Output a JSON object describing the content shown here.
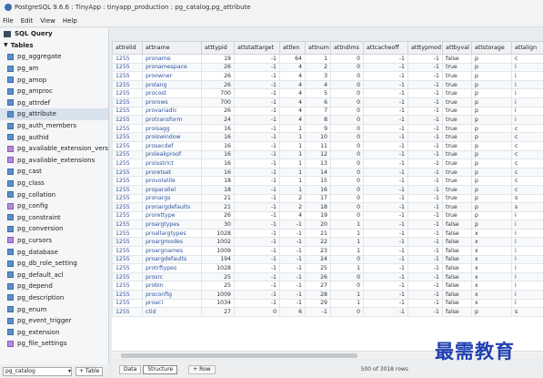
{
  "window": {
    "title": "PostgreSQL 9.6.6 : TinyApp : tinyapp_production : pg_catalog.pg_attribute"
  },
  "menu": [
    "File",
    "Edit",
    "View",
    "Help"
  ],
  "sidebar": {
    "sql_query_label": "SQL Query",
    "tables_label": "Tables",
    "items": [
      {
        "label": "pg_aggregate",
        "type": "table"
      },
      {
        "label": "pg_am",
        "type": "table"
      },
      {
        "label": "pg_amop",
        "type": "table"
      },
      {
        "label": "pg_amproc",
        "type": "table"
      },
      {
        "label": "pg_attrdef",
        "type": "table"
      },
      {
        "label": "pg_attribute",
        "type": "table",
        "selected": true
      },
      {
        "label": "pg_auth_members",
        "type": "table"
      },
      {
        "label": "pg_authid",
        "type": "table"
      },
      {
        "label": "pg_available_extension_versions",
        "type": "view"
      },
      {
        "label": "pg_available_extensions",
        "type": "view"
      },
      {
        "label": "pg_cast",
        "type": "table"
      },
      {
        "label": "pg_class",
        "type": "table"
      },
      {
        "label": "pg_collation",
        "type": "table"
      },
      {
        "label": "pg_config",
        "type": "view"
      },
      {
        "label": "pg_constraint",
        "type": "table"
      },
      {
        "label": "pg_conversion",
        "type": "table"
      },
      {
        "label": "pg_cursors",
        "type": "view"
      },
      {
        "label": "pg_database",
        "type": "table"
      },
      {
        "label": "pg_db_role_setting",
        "type": "table"
      },
      {
        "label": "pg_default_acl",
        "type": "table"
      },
      {
        "label": "pg_depend",
        "type": "table"
      },
      {
        "label": "pg_description",
        "type": "table"
      },
      {
        "label": "pg_enum",
        "type": "table"
      },
      {
        "label": "pg_event_trigger",
        "type": "table"
      },
      {
        "label": "pg_extension",
        "type": "table"
      },
      {
        "label": "pg_file_settings",
        "type": "view"
      }
    ],
    "schema_select": "pg_catalog",
    "add_table_label": "+ Table"
  },
  "grid": {
    "columns": [
      "attrelid",
      "attname",
      "atttypid",
      "attstattarget",
      "attlen",
      "attnum",
      "attndims",
      "attcacheoff",
      "atttypmod",
      "attbyval",
      "attstorage",
      "attalign"
    ],
    "rows": [
      [
        "1255",
        "proname",
        "19",
        "-1",
        "64",
        "1",
        "0",
        "-1",
        "-1",
        "false",
        "p",
        "c"
      ],
      [
        "1255",
        "pronamespace",
        "26",
        "-1",
        "4",
        "2",
        "0",
        "-1",
        "-1",
        "true",
        "p",
        "i"
      ],
      [
        "1255",
        "proowner",
        "26",
        "-1",
        "4",
        "3",
        "0",
        "-1",
        "-1",
        "true",
        "p",
        "i"
      ],
      [
        "1255",
        "prolang",
        "26",
        "-1",
        "4",
        "4",
        "0",
        "-1",
        "-1",
        "true",
        "p",
        "i"
      ],
      [
        "1255",
        "procost",
        "700",
        "-1",
        "4",
        "5",
        "0",
        "-1",
        "-1",
        "true",
        "p",
        "i"
      ],
      [
        "1255",
        "prorows",
        "700",
        "-1",
        "4",
        "6",
        "0",
        "-1",
        "-1",
        "true",
        "p",
        "i"
      ],
      [
        "1255",
        "provariadic",
        "26",
        "-1",
        "4",
        "7",
        "0",
        "-1",
        "-1",
        "true",
        "p",
        "i"
      ],
      [
        "1255",
        "protransform",
        "24",
        "-1",
        "4",
        "8",
        "0",
        "-1",
        "-1",
        "true",
        "p",
        "i"
      ],
      [
        "1255",
        "proisagg",
        "16",
        "-1",
        "1",
        "9",
        "0",
        "-1",
        "-1",
        "true",
        "p",
        "c"
      ],
      [
        "1255",
        "proiswindow",
        "16",
        "-1",
        "1",
        "10",
        "0",
        "-1",
        "-1",
        "true",
        "p",
        "c"
      ],
      [
        "1255",
        "prosecdef",
        "16",
        "-1",
        "1",
        "11",
        "0",
        "-1",
        "-1",
        "true",
        "p",
        "c"
      ],
      [
        "1255",
        "proleakproof",
        "16",
        "-1",
        "1",
        "12",
        "0",
        "-1",
        "-1",
        "true",
        "p",
        "c"
      ],
      [
        "1255",
        "proisstrict",
        "16",
        "-1",
        "1",
        "13",
        "0",
        "-1",
        "-1",
        "true",
        "p",
        "c"
      ],
      [
        "1255",
        "proretset",
        "16",
        "-1",
        "1",
        "14",
        "0",
        "-1",
        "-1",
        "true",
        "p",
        "c"
      ],
      [
        "1255",
        "provolatile",
        "18",
        "-1",
        "1",
        "15",
        "0",
        "-1",
        "-1",
        "true",
        "p",
        "c"
      ],
      [
        "1255",
        "proparallel",
        "18",
        "-1",
        "1",
        "16",
        "0",
        "-1",
        "-1",
        "true",
        "p",
        "c"
      ],
      [
        "1255",
        "pronargs",
        "21",
        "-1",
        "2",
        "17",
        "0",
        "-1",
        "-1",
        "true",
        "p",
        "s"
      ],
      [
        "1255",
        "pronargdefaults",
        "21",
        "-1",
        "2",
        "18",
        "0",
        "-1",
        "-1",
        "true",
        "p",
        "s"
      ],
      [
        "1255",
        "prorettype",
        "26",
        "-1",
        "4",
        "19",
        "0",
        "-1",
        "-1",
        "true",
        "p",
        "i"
      ],
      [
        "1255",
        "proargtypes",
        "30",
        "-1",
        "-1",
        "20",
        "1",
        "-1",
        "-1",
        "false",
        "p",
        "i"
      ],
      [
        "1255",
        "proallargtypes",
        "1028",
        "-1",
        "-1",
        "21",
        "1",
        "-1",
        "-1",
        "false",
        "x",
        "i"
      ],
      [
        "1255",
        "proargmodes",
        "1002",
        "-1",
        "-1",
        "22",
        "1",
        "-1",
        "-1",
        "false",
        "x",
        "i"
      ],
      [
        "1255",
        "proargnames",
        "1009",
        "-1",
        "-1",
        "23",
        "1",
        "-1",
        "-1",
        "false",
        "x",
        "i"
      ],
      [
        "1255",
        "proargdefaults",
        "194",
        "-1",
        "-1",
        "24",
        "0",
        "-1",
        "-1",
        "false",
        "x",
        "i"
      ],
      [
        "1255",
        "protrftypes",
        "1028",
        "-1",
        "-1",
        "25",
        "1",
        "-1",
        "-1",
        "false",
        "x",
        "i"
      ],
      [
        "1255",
        "prosrc",
        "25",
        "-1",
        "-1",
        "26",
        "0",
        "-1",
        "-1",
        "false",
        "x",
        "i"
      ],
      [
        "1255",
        "probin",
        "25",
        "-1",
        "-1",
        "27",
        "0",
        "-1",
        "-1",
        "false",
        "x",
        "i"
      ],
      [
        "1255",
        "proconfig",
        "1009",
        "-1",
        "-1",
        "28",
        "1",
        "-1",
        "-1",
        "false",
        "x",
        "i"
      ],
      [
        "1255",
        "proacl",
        "1034",
        "-1",
        "-1",
        "29",
        "1",
        "-1",
        "-1",
        "false",
        "x",
        "i"
      ],
      [
        "1255",
        "ctid",
        "27",
        "0",
        "6",
        "-1",
        "0",
        "-1",
        "-1",
        "false",
        "p",
        "s"
      ]
    ]
  },
  "bottombar": {
    "data_label": "Data",
    "structure_label": "Structure",
    "add_row_label": "+ Row",
    "status": "500 of 3018 rows"
  },
  "watermark": "最需教育"
}
